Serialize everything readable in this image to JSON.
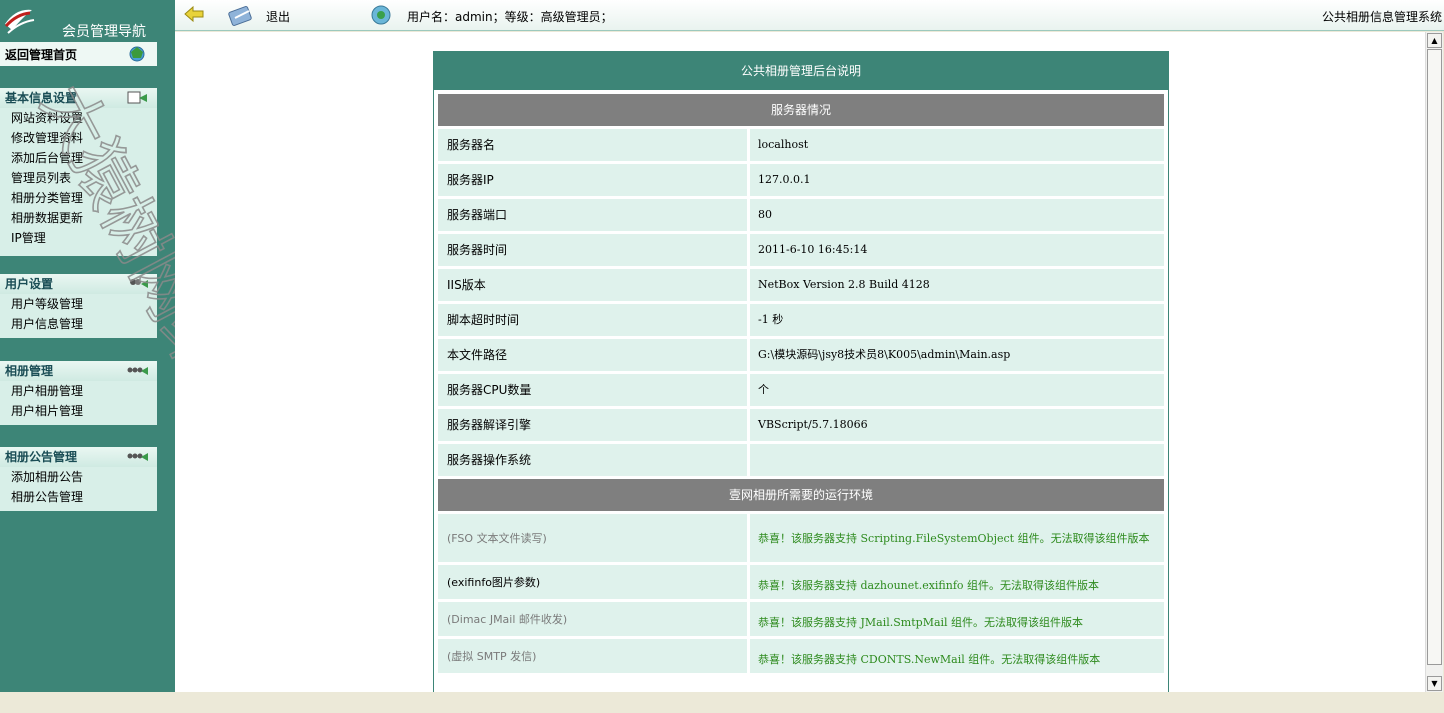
{
  "sidebar": {
    "title": "会员管理导航",
    "home": "返回管理首页",
    "groups": [
      {
        "head": "基本信息设置",
        "items": [
          "网站资料设置",
          "修改管理资料",
          "添加后台管理",
          "管理员列表",
          "相册分类管理",
          "相册数据更新",
          "IP管理"
        ]
      },
      {
        "head": "用户设置",
        "items": [
          "用户等级管理",
          "用户信息管理"
        ]
      },
      {
        "head": "相册管理",
        "items": [
          "用户相册管理",
          "用户相片管理"
        ]
      },
      {
        "head": "相册公告管理",
        "items": [
          "添加相册公告",
          "相册公告管理"
        ]
      }
    ],
    "watermark": "大猿树网络"
  },
  "topbar": {
    "logout": "退出",
    "user_info": "用户名：admin；等级：高级管理员；",
    "system_name": "公共相册信息管理系统"
  },
  "panel": {
    "title": "公共相册管理后台说明",
    "server_head": "服务器情况",
    "server_rows": [
      {
        "k": "服务器名",
        "v": "localhost"
      },
      {
        "k": "服务器IP",
        "v": "127.0.0.1"
      },
      {
        "k": "服务器端口",
        "v": "80"
      },
      {
        "k": "服务器时间",
        "v": "2011-6-10 16:45:14"
      },
      {
        "k": "IIS版本",
        "v": "NetBox Version 2.8 Build 4128"
      },
      {
        "k": "脚本超时时间",
        "v": "-1 秒"
      },
      {
        "k": "本文件路径",
        "v": "G:\\模块源码\\jsy8技术员8\\K005\\admin\\Main.asp"
      },
      {
        "k": "服务器CPU数量",
        "v": " 个"
      },
      {
        "k": "服务器解译引擎",
        "v": "VBScript/5.7.18066"
      },
      {
        "k": "服务器操作系统",
        "v": ""
      }
    ],
    "env_head": "壹网相册所需要的运行环境",
    "env_rows": [
      {
        "k": "(FSO 文本文件读写)",
        "v": "恭喜！该服务器支持 Scripting.FileSystemObject 组件。无法取得该组件版本"
      },
      {
        "k": "(exifinfo图片参数)",
        "v": "恭喜！该服务器支持 dazhounet.exifinfo 组件。无法取得该组件版本"
      },
      {
        "k": "(Dimac JMail 邮件收发)",
        "v": "恭喜！该服务器支持 JMail.SmtpMail 组件。无法取得该组件版本"
      },
      {
        "k": "(虚拟 SMTP 发信)",
        "v": "恭喜！该服务器支持 CDONTS.NewMail 组件。无法取得该组件版本"
      }
    ]
  },
  "colors": {
    "sidebar_bg": "#3d8577",
    "row_bg": "#dff2ec",
    "section_gray": "#7f7f7f",
    "ok_green": "#2e8b1e"
  }
}
